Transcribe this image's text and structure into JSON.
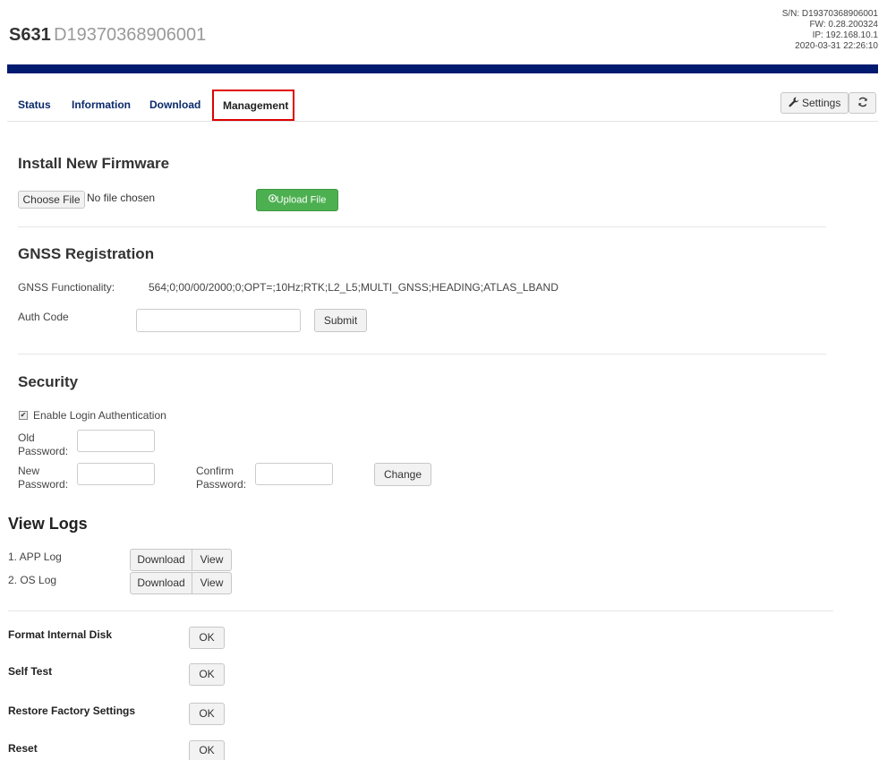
{
  "header": {
    "model": "S631",
    "serial": "D19370368906001",
    "device_info": {
      "sn": "S/N: D19370368906001",
      "fw": "FW: 0.28.200324",
      "ip": "IP: 192.168.10.1",
      "datetime": "2020-03-31 22:26:10"
    }
  },
  "nav": {
    "tabs": [
      {
        "label": "Status"
      },
      {
        "label": "Information"
      },
      {
        "label": "Download"
      },
      {
        "label": "Management"
      }
    ],
    "settings_label": "Settings",
    "settings_icon": "wrench-icon",
    "refresh_icon": "refresh-icon",
    "accent": "#001a70",
    "highlight": "#dd0000"
  },
  "firmware": {
    "title": "Install New Firmware",
    "choose_label": "Choose File",
    "file_status": "No file chosen",
    "upload_label": "Upload File",
    "upload_icon": "upload-icon",
    "upload_color": "#4caf50"
  },
  "gnss": {
    "title": "GNSS Registration",
    "functionality_label": "GNSS Functionality:",
    "functionality_value": "564;0;00/00/2000;0;OPT=;10Hz;RTK;L2_L5;MULTI_GNSS;HEADING;ATLAS_LBAND",
    "auth_label": "Auth Code",
    "auth_value": "",
    "submit_label": "Submit"
  },
  "security": {
    "title": "Security",
    "enable_auth_label": "Enable Login Authentication",
    "enable_auth_checked": true,
    "old_password_label_1": "Old",
    "old_password_label_2": "Password:",
    "new_password_label_1": "New",
    "new_password_label_2": "Password:",
    "confirm_password_label_1": "Confirm",
    "confirm_password_label_2": "Password:",
    "change_label": "Change"
  },
  "logs": {
    "title": "View Logs",
    "items": [
      {
        "label": "1. APP Log",
        "download": "Download",
        "view": "View"
      },
      {
        "label": "2. OS Log",
        "download": "Download",
        "view": "View"
      }
    ]
  },
  "actions": [
    {
      "label": "Format Internal Disk",
      "button": "OK"
    },
    {
      "label": "Self Test",
      "button": "OK"
    },
    {
      "label": "Restore Factory Settings",
      "button": "OK"
    },
    {
      "label": "Reset",
      "button": "OK"
    }
  ]
}
